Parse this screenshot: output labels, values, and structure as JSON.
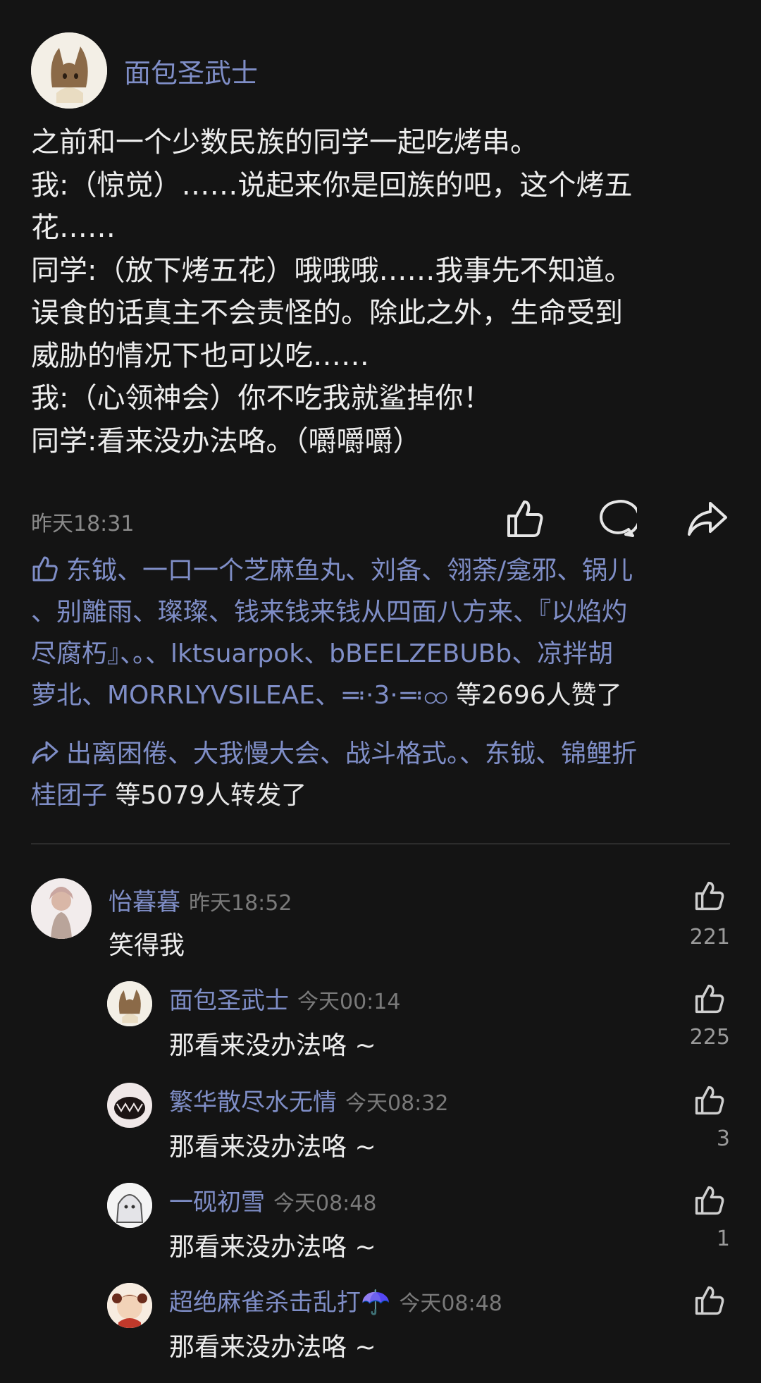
{
  "post": {
    "author": "面包圣武士",
    "lines": [
      "之前和一个少数民族的同学一起吃烤串。",
      "我:（惊觉）……说起来你是回族的吧，这个烤五",
      "花……",
      "同学:（放下烤五花）哦哦哦……我事先不知道。",
      "误食的话真主不会责怪的。除此之外，生命受到",
      "威胁的情况下也可以吃……",
      "我:（心领神会）你不吃我就鲨掉你！",
      "同学:看来没办法咯。（嚼嚼嚼）"
    ],
    "time": "昨天18:31",
    "actions": [
      "like-icon",
      "comment-icon",
      "share-icon"
    ]
  },
  "likes": {
    "icon": "thumbs-up-icon",
    "lines": [
      "东钺、一口一个芝麻鱼丸、刘备、翎荼/龛邪、锅儿",
      "、别離雨、璨璨、钱来钱来钱从四面八方来、『以焰灼",
      "尽腐朽』、。、lktsuarpok、bBEELZEBUBb、凉拌胡",
      "萝北、MORRLYVSILEAE、≕·3·≕ထ"
    ],
    "tail": " 等2696人赞了"
  },
  "reposts": {
    "icon": "repost-arrow-icon",
    "lines": [
      "出离困倦、大我慢大会、战斗格式。、东钺、锦鲤折",
      "桂团子"
    ],
    "tail": " 等5079人转发了"
  },
  "comments": [
    {
      "name": "怡暮暮",
      "time": "昨天18:52",
      "text": "笑得我",
      "count": "221"
    },
    {
      "name": "面包圣武士",
      "time": "今天00:14",
      "text": "那看来没办法咯 ~",
      "count": "225"
    },
    {
      "name": "繁华散尽水无情",
      "time": "今天08:32",
      "text": "那看来没办法咯 ~",
      "count": "3"
    },
    {
      "name": "一砚初雪",
      "time": "今天08:48",
      "text": "那看来没办法咯 ~",
      "count": "1"
    },
    {
      "name": "超绝麻雀杀击乱打☂️",
      "time": "今天08:48",
      "text": "那看来没办法咯 ~",
      "count": ""
    }
  ],
  "colors": {
    "background": "#141414",
    "link": "#7f8ec7",
    "text": "#ededed",
    "muted": "#8a8a8a"
  }
}
